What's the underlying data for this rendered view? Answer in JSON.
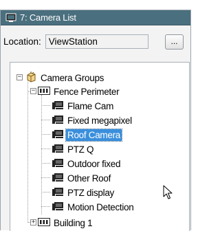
{
  "window": {
    "title": "7: Camera List",
    "icon": "camera-list-icon"
  },
  "location": {
    "label": "Location:",
    "value": "ViewStation",
    "browse_label": "..."
  },
  "tree": {
    "root": {
      "label": "Camera Groups",
      "expanded": true
    },
    "groups": [
      {
        "label": "Fence Perimeter",
        "expanded": true,
        "cameras": [
          {
            "label": "Flame Cam"
          },
          {
            "label": "Fixed megapixel"
          },
          {
            "label": "Roof Camera",
            "selected": true
          },
          {
            "label": "PTZ Q"
          },
          {
            "label": "Outdoor fixed"
          },
          {
            "label": "Other Roof"
          },
          {
            "label": "PTZ display"
          },
          {
            "label": "Motion Detection"
          }
        ]
      },
      {
        "label": "Building 1",
        "expanded": false
      }
    ]
  },
  "colors": {
    "titlebar": "#4a6f7e",
    "selection": "#3a8fdc"
  }
}
